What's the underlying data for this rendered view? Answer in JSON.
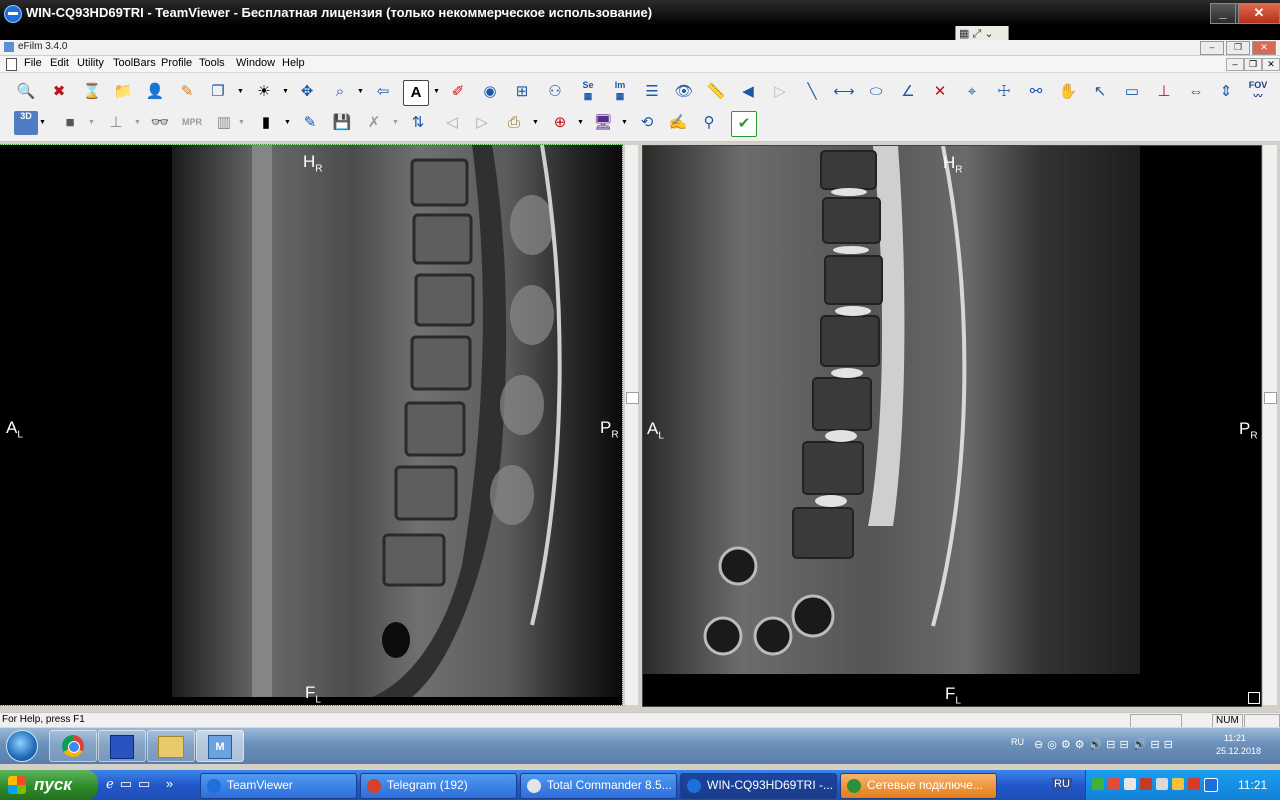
{
  "teamviewer": {
    "title": "WIN-CQ93HD69TRI - TeamViewer - Бесплатная лицензия (только некоммерческое использование)"
  },
  "efilm": {
    "title": "eFilm 3.4.0",
    "menu": [
      "File",
      "Edit",
      "Utility",
      "ToolBars",
      "Profile",
      "Tools",
      "Window",
      "Help"
    ],
    "toolbar_text": {
      "se": "Se",
      "im": "Im",
      "fov": "FOV",
      "mpr": "MPR",
      "three_d": "3D"
    }
  },
  "viewports": [
    {
      "top": "H",
      "top_sub": "R",
      "left": "A",
      "left_sub": "L",
      "right": "P",
      "right_sub": "R",
      "bottom": "F",
      "bottom_sub": "L"
    },
    {
      "top": "H",
      "top_sub": "R",
      "left": "A",
      "left_sub": "L",
      "right": "P",
      "right_sub": "R",
      "bottom": "F",
      "bottom_sub": "L"
    }
  ],
  "statusbar": {
    "help": "For Help, press F1",
    "num": "NUM"
  },
  "remote_taskbar": {
    "lang": "RU",
    "time": "11:21",
    "date": "25.12.2018"
  },
  "local_taskbar": {
    "start": "пуск",
    "tasks": [
      "TeamViewer",
      "Telegram (192)",
      "Total Commander 8.5...",
      "WIN-CQ93HD69TRI -...",
      "Сетевые подключе..."
    ],
    "lang": "RU",
    "time": "11:21"
  }
}
